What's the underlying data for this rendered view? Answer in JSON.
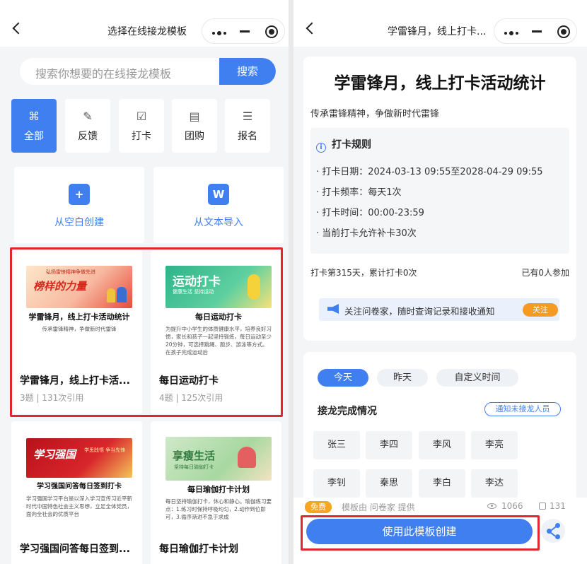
{
  "left": {
    "nav": {
      "title": "选择在线接龙模板"
    },
    "search": {
      "placeholder": "搜索你想要的在线接龙模板",
      "button": "搜索"
    },
    "categories": [
      {
        "label": "全部",
        "icon": "grid-icon"
      },
      {
        "label": "反馈",
        "icon": "edit-icon"
      },
      {
        "label": "打卡",
        "icon": "calendar-check-icon"
      },
      {
        "label": "团购",
        "icon": "shop-icon"
      },
      {
        "label": "报名",
        "icon": "list-icon"
      }
    ],
    "import": [
      {
        "label": "从空白创建",
        "icon": "new-file-icon"
      },
      {
        "label": "从文本导入",
        "icon": "word-icon"
      }
    ],
    "templates": [
      {
        "banner": "榜样的力量",
        "banner_top": "弘扬雷锋精神争做先进",
        "title": "学雷锋月，线上打卡活动统计",
        "subtitle": "传承雷锋精神，争做新时代雷锋",
        "name": "学雷锋月，线上打卡活...",
        "meta": "3题 | 131次引用"
      },
      {
        "banner": "运动打卡",
        "banner_sub": "健康生活 坚持运动",
        "title": "每日运动打卡",
        "subtitle": "为提升中小学生的体质健康水平，培养良好习惯，家长和孩子一起坚持锻炼，每日运动至少20分钟，可选择跳绳、跑步、游泳等方式。在孩子完成运动后",
        "name": "每日运动打卡",
        "meta": "4题 | 125次引用"
      },
      {
        "banner": "学习强国",
        "banner_right": "学思践悟 争当先锋",
        "title": "学习强国问答每日签到打卡",
        "subtitle": "学习强国学习平台是以深入学习宣传习近平新时代中国特色社会主义思想，立足全体党员，面向全社会的优质平台",
        "name": "学习强国问答每日签到...",
        "meta": ""
      },
      {
        "banner": "享瘦生活",
        "banner_sub": "坚持每日瑜伽打卡",
        "title": "每日瑜伽打卡计划",
        "subtitle": "每日坚持瑜伽打卡，休心和静心。瑜伽练习要点：1.练习时保持呼吸均匀，2.动作到位即可，3.循序渐进不急于求成",
        "name": "每日瑜伽打卡计划",
        "meta": ""
      }
    ]
  },
  "right": {
    "nav": {
      "title": "学雷锋月，线上打卡..."
    },
    "title": "学雷锋月，线上打卡活动统计",
    "subtitle": "传承雷锋精神，争做新时代雷锋",
    "rules": {
      "heading": "打卡规则",
      "items": [
        "· 打卡日期：2024-03-13 09:55至2028-04-29 09:55",
        "· 打卡频率：每天1次",
        "· 打卡时间：00:00-23:59",
        "· 当前打卡允许补卡30次"
      ]
    },
    "stats": {
      "left": "打卡第315天，累计打卡0次",
      "right": "已有0人参加"
    },
    "follow": {
      "text": "关注问卷家，随时查询记录和接收通知",
      "button": "关注"
    },
    "tabs": [
      "今天",
      "昨天",
      "自定义时间"
    ],
    "completion": {
      "heading": "接龙完成情况",
      "notify": "通知未接龙人员"
    },
    "people": [
      "张三",
      "李四",
      "李风",
      "李亮",
      "李钊",
      "秦思",
      "李白",
      "李达"
    ],
    "bottom": {
      "free": "免费",
      "source": "模板由 问卷家 提供",
      "views": "1066",
      "copies": "131",
      "use": "使用此模板创建"
    }
  },
  "colors": {
    "accent": "#3f7ff0",
    "highlight": "#e3262e",
    "badge": "#f5a623"
  }
}
